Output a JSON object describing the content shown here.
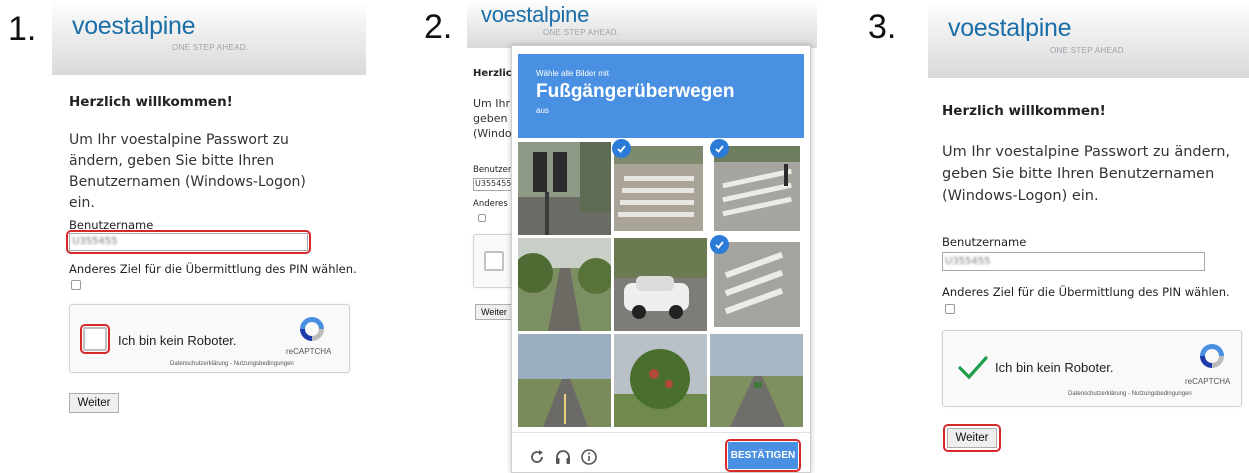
{
  "steps": [
    "1.",
    "2.",
    "3."
  ],
  "brand": {
    "logo": "voestalpine",
    "tagline": "ONE STEP AHEAD."
  },
  "form": {
    "welcome": "Herzlich willkommen!",
    "intro": "Um Ihr voestalpine Passwort zu ändern, geben Sie bitte Ihren Benutzernamen (Windows-Logon) ein.",
    "username_label": "Benutzername",
    "username_value_blurred": "U355455",
    "alt_target_label": "Anderes Ziel für die Übermittlung des PIN wählen.",
    "submit_label": "Weiter"
  },
  "recaptcha": {
    "checkbox_label": "Ich bin kein Roboter.",
    "brand": "reCAPTCHA",
    "legal": "Datenschutzerklärung - Nutzungsbedingungen"
  },
  "step2_partial": {
    "welcome": "Herzlich",
    "intro_lines": [
      "Um Ihr",
      "geben S",
      "(Windo"
    ],
    "username_label": "Benutzer",
    "username_value": "U355455",
    "alt_target_label": "Anderes",
    "submit_label": "Weiter"
  },
  "challenge": {
    "instruction": "Wähle alle Bilder mit",
    "object": "Fußgängerüberwegen",
    "suffix": "aus",
    "confirm_label": "BESTÄTIGEN",
    "tiles": [
      {
        "id": 1,
        "scene": "traffic-light",
        "selected": false
      },
      {
        "id": 2,
        "scene": "crosswalk",
        "selected": true
      },
      {
        "id": 3,
        "scene": "crosswalk",
        "selected": true
      },
      {
        "id": 4,
        "scene": "street",
        "selected": false
      },
      {
        "id": 5,
        "scene": "parked-car",
        "selected": false
      },
      {
        "id": 6,
        "scene": "crosswalk",
        "selected": true
      },
      {
        "id": 7,
        "scene": "road",
        "selected": false
      },
      {
        "id": 8,
        "scene": "tree",
        "selected": false
      },
      {
        "id": 9,
        "scene": "road",
        "selected": false
      }
    ]
  },
  "colors": {
    "highlight": "#d62a2a",
    "brand_blue": "#1a6fa8",
    "challenge_blue": "#4a90e2",
    "check_green": "#1f9e4a"
  }
}
